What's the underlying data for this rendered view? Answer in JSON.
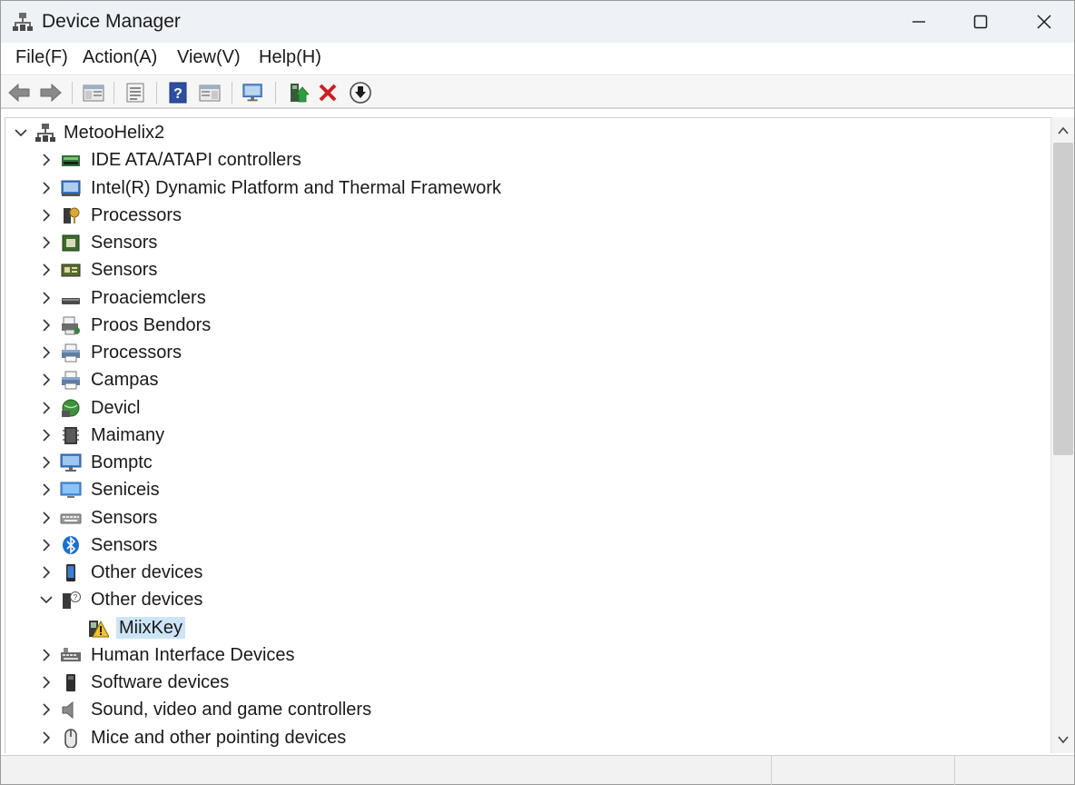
{
  "window": {
    "title": "Device Manager"
  },
  "menu": {
    "file": "File(F)",
    "action": "Action(A)",
    "view": "View(V)",
    "help": "Help(H)"
  },
  "tree": {
    "root": "MetooHelix2",
    "nodes": [
      {
        "label": "IDE ATA/ATAPI controllers",
        "icon": "ide-controller-icon",
        "expanded": false
      },
      {
        "label": "Intel(R) Dynamic Platform and Thermal Framework",
        "icon": "thermal-framework-icon",
        "expanded": false
      },
      {
        "label": "Processors",
        "icon": "processor-key-icon",
        "expanded": false
      },
      {
        "label": "Sensors",
        "icon": "chip-icon",
        "expanded": false
      },
      {
        "label": "Sensors",
        "icon": "board-icon",
        "expanded": false
      },
      {
        "label": "Proaciemclers",
        "icon": "drive-icon",
        "expanded": false
      },
      {
        "label": "Proos Bendors",
        "icon": "printer-queue-icon",
        "expanded": false
      },
      {
        "label": "Processors",
        "icon": "printer-icon",
        "expanded": false
      },
      {
        "label": "Campas",
        "icon": "printer-icon",
        "expanded": false
      },
      {
        "label": "Devicl",
        "icon": "globe-device-icon",
        "expanded": false
      },
      {
        "label": "Maimany",
        "icon": "memory-icon",
        "expanded": false
      },
      {
        "label": "Bomptc",
        "icon": "monitor-icon",
        "expanded": false
      },
      {
        "label": "Seniceis",
        "icon": "display-icon",
        "expanded": false
      },
      {
        "label": "Sensors",
        "icon": "keyboard-icon",
        "expanded": false
      },
      {
        "label": "Sensors",
        "icon": "bluetooth-icon",
        "expanded": false
      },
      {
        "label": "Other devices",
        "icon": "phone-icon",
        "expanded": false
      },
      {
        "label": "Other devices",
        "icon": "unknown-device-icon",
        "expanded": true
      },
      {
        "label": "MiixKey",
        "icon": "warning-device-icon",
        "child": true,
        "selected": true
      },
      {
        "label": "Human Interface Devices",
        "icon": "hid-icon",
        "expanded": false
      },
      {
        "label": "Software devices",
        "icon": "software-device-icon",
        "expanded": false
      },
      {
        "label": "Sound, video and game controllers",
        "icon": "speaker-icon",
        "expanded": false
      },
      {
        "label": "Mice and other pointing devices",
        "icon": "mouse-icon",
        "expanded": false
      }
    ]
  },
  "colors": {
    "selection": "#cce4f7",
    "titlebar": "#eef2f7",
    "delete_red": "#cc1f1f"
  }
}
